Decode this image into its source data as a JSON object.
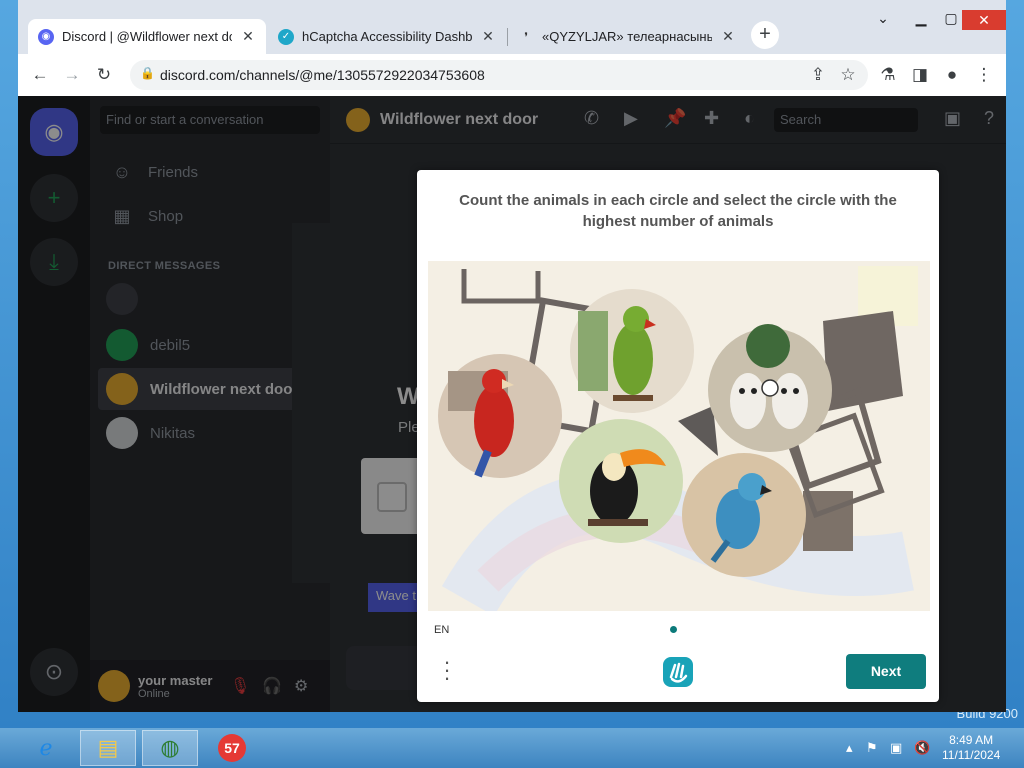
{
  "browser": {
    "tabs": [
      {
        "title": "Discord | @Wildflower next door",
        "active": true
      },
      {
        "title": "hCaptcha Accessibility Dashboard",
        "active": false
      },
      {
        "title": "«QYZYLJAR» телеарнасының ресми сайты",
        "active": false
      }
    ],
    "url": "discord.com/channels/@me/1305572922034753608",
    "new_tab": "+"
  },
  "discord": {
    "search_placeholder": "Find or start a conversation",
    "nav": {
      "friends": "Friends",
      "shop": "Shop"
    },
    "dm_header": "DIRECT MESSAGES",
    "dms": [
      {
        "name": "debil5",
        "selected": false
      },
      {
        "name": "Wildflower next door",
        "selected": true
      },
      {
        "name": "Nikitas",
        "selected": false
      }
    ],
    "channel_title": "Wildflower next door",
    "header_search": "Search",
    "wave_button": "Wave t",
    "user": {
      "name": "your master",
      "status": "Online"
    },
    "modal": {
      "title": "W",
      "subtitle": "Ple"
    }
  },
  "hcaptcha": {
    "prompt": "Count the animals in each circle and select the circle with the highest number of animals",
    "language": "EN",
    "next_label": "Next"
  },
  "taskbar": {
    "badge": "57",
    "time": "8:49 AM",
    "date": "11/11/2024",
    "build": "Build 9200"
  },
  "colors": {
    "discord_bg": "#313338",
    "hcaptcha_accent": "#0f7d7e",
    "tab_active": "#ffffff"
  }
}
